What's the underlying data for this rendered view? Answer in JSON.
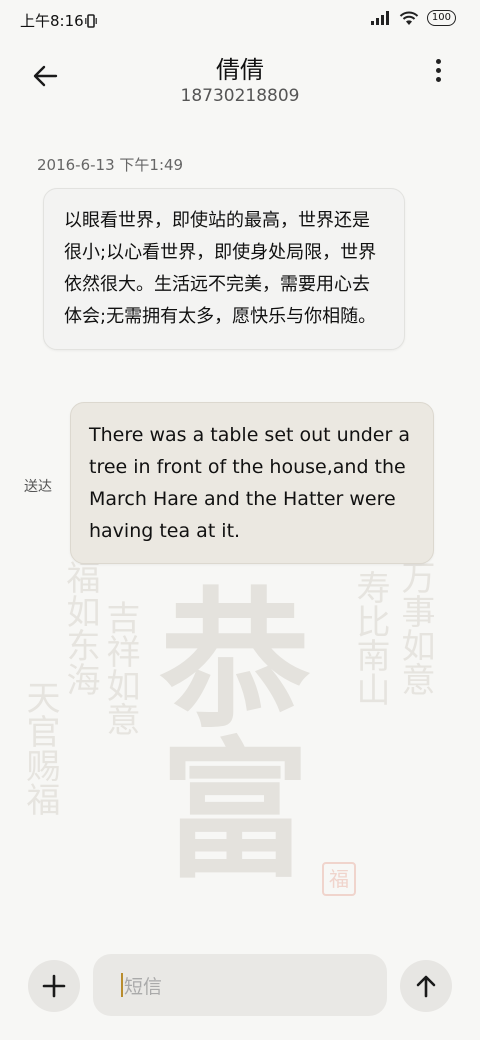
{
  "status_bar": {
    "time": "上午8:16",
    "battery": "100",
    "icons": [
      "vibrate-icon",
      "signal-icon",
      "wifi-icon",
      "battery-icon"
    ]
  },
  "header": {
    "title": "倩倩",
    "phone_number": "18730218809"
  },
  "conversation": {
    "timestamp": "2016-6-13 下午1:49",
    "incoming_message": "以眼看世界，即使站的最高，世界还是很小;以心看世界，即使身处局限，世界依然很大。生活远不完美，需要用心去体会;无需拥有太多，愿快乐与你相随。",
    "outgoing_message": "There was a table set out under a tree in front of the house,and the March Hare and the Hatter were having tea at it.",
    "delivery_status": "送达"
  },
  "composer": {
    "placeholder": "短信"
  },
  "colors": {
    "background": "#f7f7f5",
    "incoming_bubble": "#f3f3f2",
    "outgoing_bubble": "#ebe8e1",
    "caret": "#b98d2e"
  }
}
